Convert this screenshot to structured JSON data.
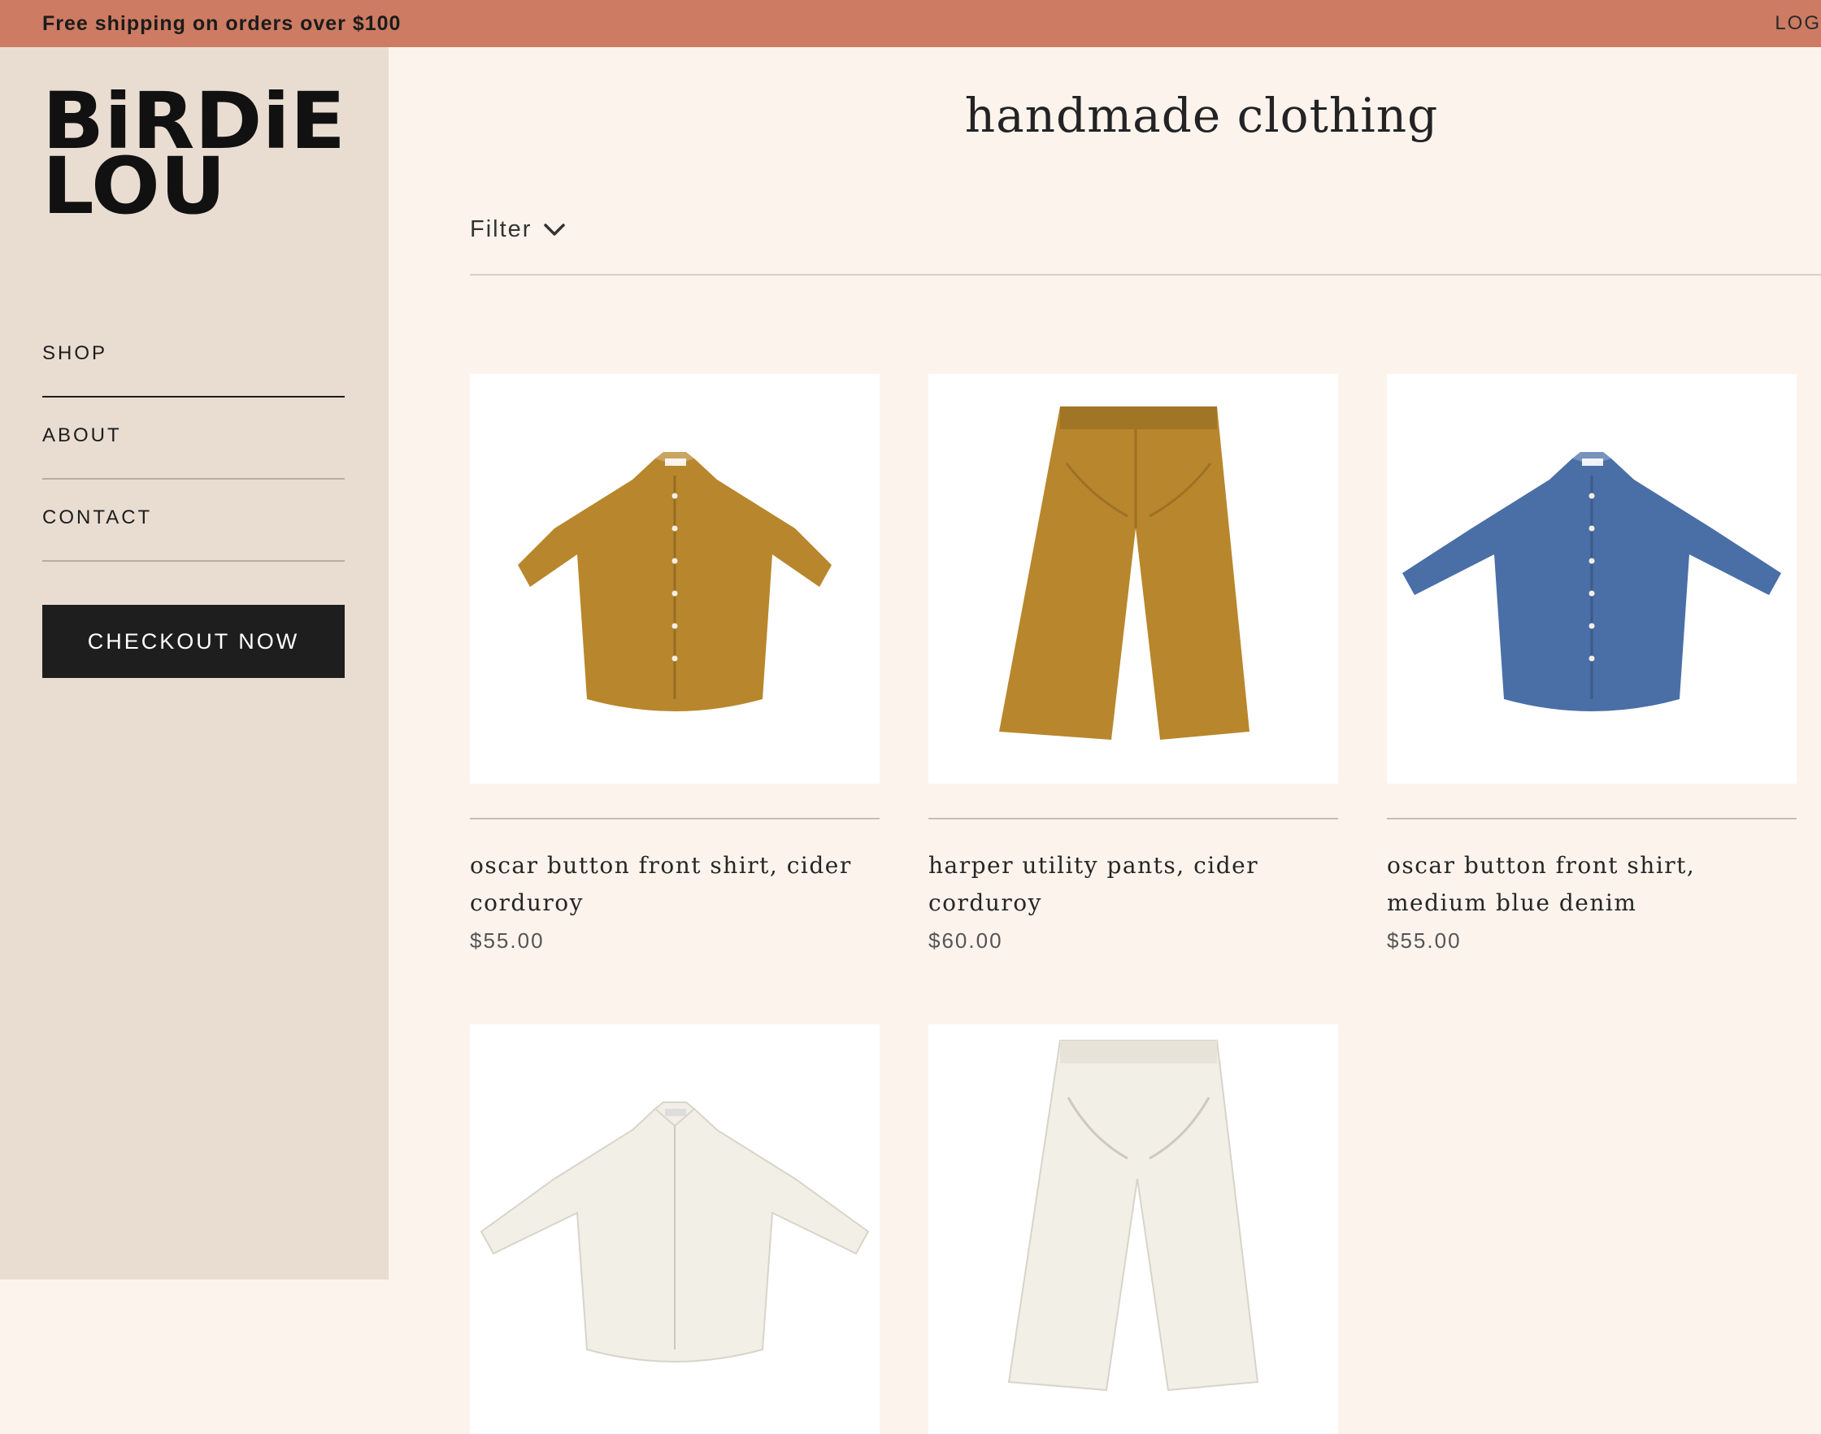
{
  "announcement": {
    "text": "Free shipping on orders over $100",
    "login_label": "LOG"
  },
  "brand": {
    "line1": "BiRDiE",
    "line2": "LOU"
  },
  "nav": {
    "items": [
      {
        "label": "SHOP"
      },
      {
        "label": "ABOUT"
      },
      {
        "label": "CONTACT"
      }
    ]
  },
  "checkout": {
    "label": "CHECKOUT NOW"
  },
  "page": {
    "title": "handmade clothing",
    "filter_label": "Filter"
  },
  "products": [
    {
      "name": "oscar button front shirt, cider corduroy",
      "price": "$55.00",
      "icon": "shirt",
      "color": "#b8862c"
    },
    {
      "name": "harper utility pants, cider corduroy",
      "price": "$60.00",
      "icon": "pants",
      "color": "#b8862c"
    },
    {
      "name": "oscar button front shirt, medium blue denim",
      "price": "$55.00",
      "icon": "shirt",
      "color": "#4a6ea6"
    },
    {
      "name": "",
      "price": "",
      "icon": "shirt",
      "color": "#f2efe7"
    },
    {
      "name": "",
      "price": "",
      "icon": "pants",
      "color": "#f2efe7"
    }
  ],
  "colors": {
    "banner": "#cd7b63",
    "sidebar": "#e9ddd2",
    "background": "#fcf4ec",
    "button": "#1e1e1e"
  }
}
